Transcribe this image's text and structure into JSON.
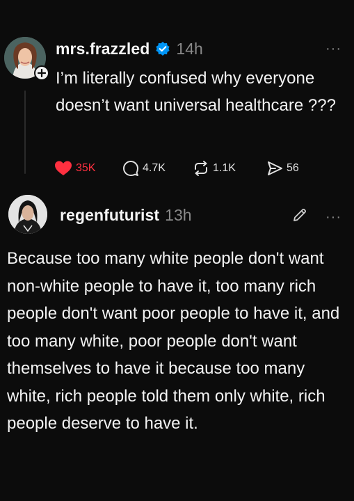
{
  "post1": {
    "username": "mrs.frazzled",
    "time": "14h",
    "text": "I’m literally confused why everyone doesn’t want universal healthcare ???",
    "likes": "35K",
    "replies": "4.7K",
    "reposts": "1.1K",
    "shares": "56",
    "more": "···"
  },
  "post2": {
    "username": "regenfuturist",
    "time": "13h",
    "text": "Because too many white people don't want non-white people to have it, too many rich people don't want poor people to have it, and too many white, poor people don't want themselves to have it because too many white, rich people told them only white, rich people deserve to have it.",
    "more": "···"
  },
  "icons": {
    "verified": "verified-badge-icon",
    "follow": "plus-icon",
    "like": "heart-icon",
    "reply": "comment-bubble-icon",
    "repost": "repost-icon",
    "share": "send-icon",
    "edit": "pencil-icon"
  },
  "colors": {
    "background": "#0c0c0c",
    "like_active": "#ff3040",
    "verified": "#0095f6",
    "muted": "#8a8a8a"
  }
}
